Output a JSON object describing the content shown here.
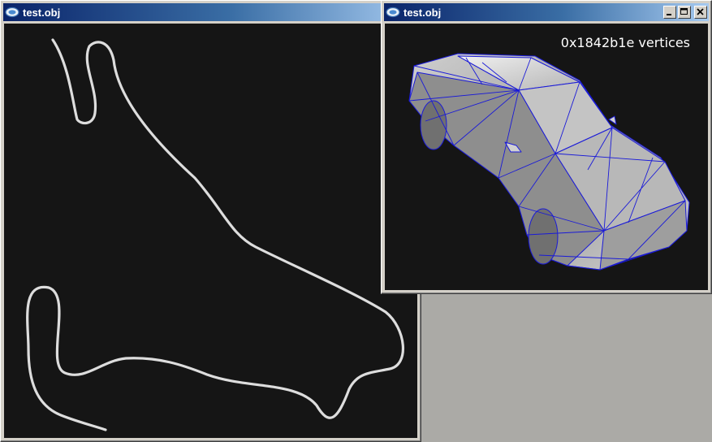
{
  "windows": {
    "left": {
      "title": "test.obj"
    },
    "right": {
      "title": "test.obj",
      "overlay_text": "0x1842b1e vertices"
    }
  },
  "icons": {
    "app": "app-window-icon",
    "minimize": "minimize-icon",
    "maximize": "maximize-icon",
    "close": "close-icon"
  },
  "colors": {
    "desktop": "#abaaa6",
    "titlebar_start": "#0a246a",
    "titlebar_end": "#a6caf0",
    "canvas": "#151515",
    "curve": "#dddddd",
    "wireframe": "#1a1ad8"
  }
}
